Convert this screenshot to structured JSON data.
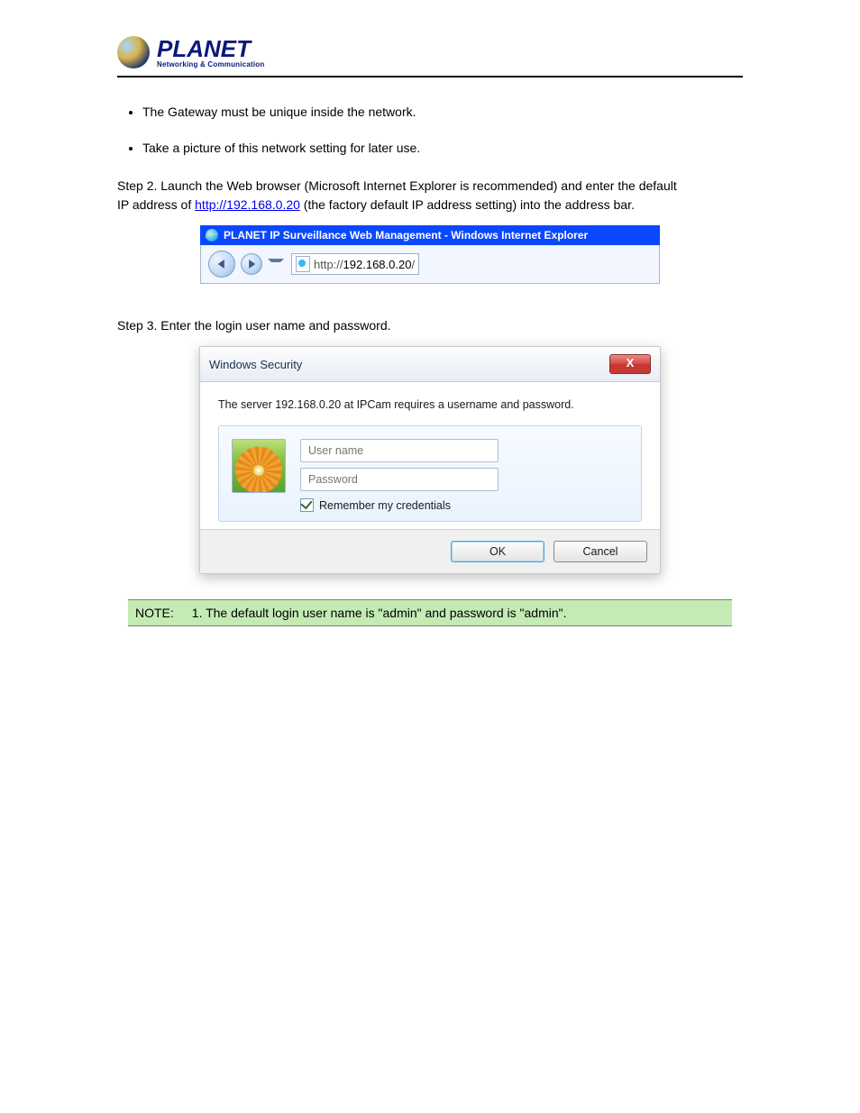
{
  "logo": {
    "main": "PLANET",
    "sub": "Networking & Communication"
  },
  "bullets": [
    "The Gateway must be unique inside the network.",
    "Take a picture of this network setting for later use."
  ],
  "step2": {
    "line1_prefix": "Step 2. ",
    "line1_rest": "Launch the Web browser (Microsoft Internet Explorer is recommended) and enter the default",
    "line2_prefix": "IP address of ",
    "link": "http://192.168.0.20",
    "line2_rest": "(the factory default IP address setting) into the address bar."
  },
  "ie_titlebar": "PLANET IP Surveillance Web Management - Windows Internet Explorer",
  "ie_addr_prefix": "http://",
  "ie_addr_host": "192.168.0.20",
  "ie_addr_suffix": "/",
  "step3": "Step 3. Enter the login user name and password.",
  "dialog": {
    "title": "Windows Security",
    "close": "X",
    "message": "The server 192.168.0.20 at IPCam requires a username and password.",
    "username_placeholder": "User name",
    "password_placeholder": "Password",
    "remember": "Remember my credentials",
    "ok": "OK",
    "cancel": "Cancel"
  },
  "note": {
    "label": "NOTE:",
    "text": "1. The default login user name is \"admin\" and password is \"admin\"."
  }
}
